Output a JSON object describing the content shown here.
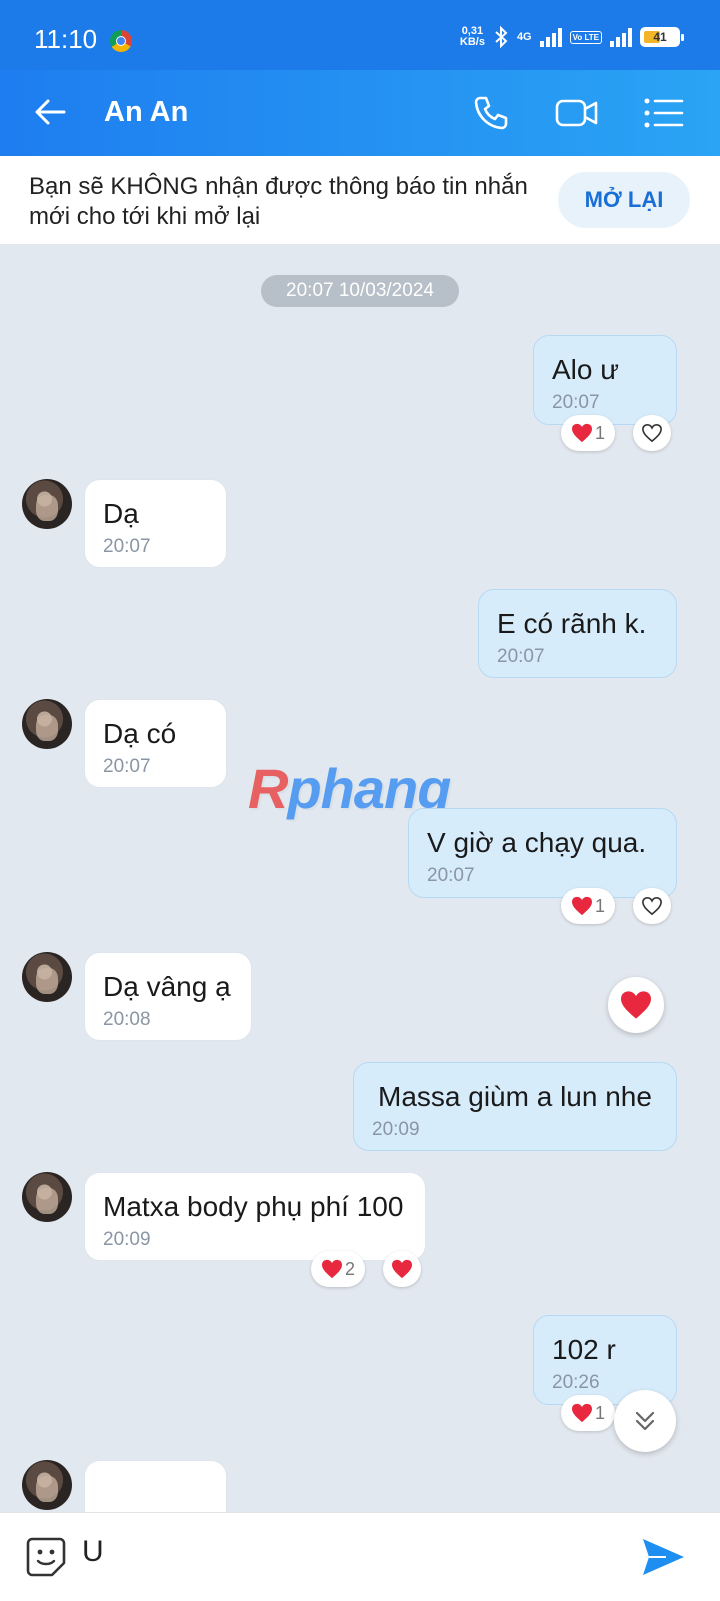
{
  "status_bar": {
    "time": "11:10",
    "speed_value": "0,31",
    "speed_unit": "KB/s",
    "network": "4G",
    "volte": "Vo LTE",
    "battery": "41"
  },
  "header": {
    "contact_name": "An An"
  },
  "notice": {
    "text": "Bạn sẽ KHÔNG nhận được thông báo tin nhắn mới cho tới khi mở lại",
    "button": "MỞ LẠI"
  },
  "chat": {
    "date": "20:07 10/03/2024",
    "messages": [
      {
        "dir": "out",
        "text": "Alo ư",
        "time": "20:07",
        "reaction_count": "1"
      },
      {
        "dir": "in",
        "text": "Dạ",
        "time": "20:07"
      },
      {
        "dir": "out",
        "text": "E có rãnh k.",
        "time": "20:07"
      },
      {
        "dir": "in",
        "text": "Dạ có",
        "time": "20:07"
      },
      {
        "dir": "out",
        "text": "V giờ a chạy qua.",
        "time": "20:07",
        "reaction_count": "1"
      },
      {
        "dir": "in",
        "text": "Dạ vâng ạ",
        "time": "20:08"
      },
      {
        "dir": "out",
        "text": "Massa giùm a lun nhe",
        "time": "20:09"
      },
      {
        "dir": "in",
        "text": "Matxa body phụ phí 100",
        "time": "20:09",
        "reaction_count": "2"
      },
      {
        "dir": "out",
        "text": "102 r",
        "time": "20:26",
        "reaction_count": "1"
      }
    ]
  },
  "watermark": {
    "r": "R",
    "rest": "phang"
  },
  "composer": {
    "value": "U"
  },
  "colors": {
    "header_start": "#1e7df0",
    "header_end": "#2aa4f4",
    "outgoing_bubble": "#d7ecfb",
    "incoming_bubble": "#ffffff",
    "chat_background": "#e2e8ef",
    "heart": "#e8283f"
  },
  "icons": {
    "back": "arrow-left-icon",
    "call": "phone-icon",
    "video": "video-camera-icon",
    "menu": "list-menu-icon",
    "heart": "heart-icon",
    "heart_outline": "heart-outline-icon",
    "scroll_down": "double-chevron-down-icon",
    "sticker": "sticker-smile-icon",
    "send": "send-icon"
  }
}
